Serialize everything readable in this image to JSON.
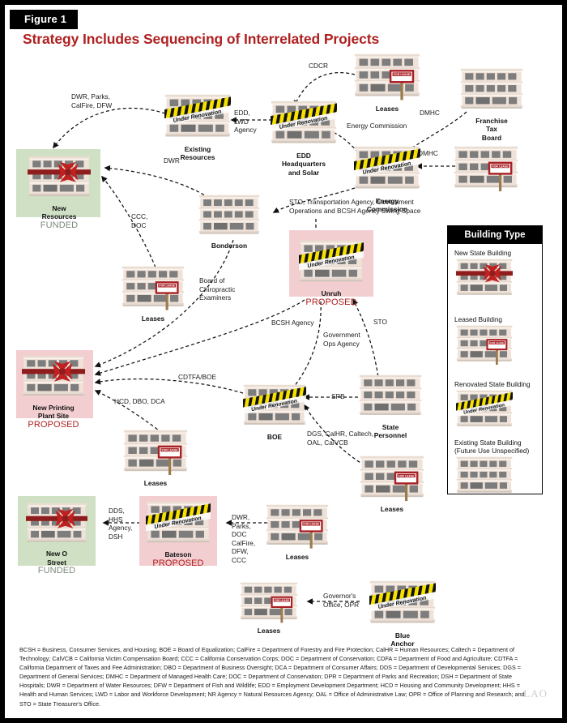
{
  "figure": {
    "tag": "Figure 1",
    "title": "Strategy Includes Sequencing of Interrelated Projects",
    "logo": "LAO"
  },
  "legend": {
    "header": "Building Type",
    "items": [
      {
        "label": "New State Building",
        "icon": "new-state-building-icon"
      },
      {
        "label": "Leased Building",
        "icon": "leased-building-icon"
      },
      {
        "label": "Renovated State Building",
        "icon": "renovated-state-building-icon"
      },
      {
        "label": "Existing State Building\n(Future Use Unspecified)",
        "icon": "existing-state-building-icon"
      }
    ]
  },
  "nodes": [
    {
      "id": "leases_top",
      "caption": "Leases",
      "status": "",
      "type": "leased"
    },
    {
      "id": "franchise_tax",
      "caption": "Franchise\nTax Board",
      "status": "",
      "type": "existing"
    },
    {
      "id": "existing_resources",
      "caption": "Existing Resources",
      "status": "",
      "type": "renovated"
    },
    {
      "id": "edd_hq",
      "caption": "EDD Headquarters\nand Solar",
      "status": "",
      "type": "renovated"
    },
    {
      "id": "energy_commission",
      "caption": "Energy Commission",
      "status": "",
      "type": "renovated"
    },
    {
      "id": "leases_dmhc",
      "caption": "",
      "status": "",
      "type": "leased"
    },
    {
      "id": "new_resources",
      "caption": "New Resources",
      "status": "FUNDED",
      "type": "new",
      "shade": "green"
    },
    {
      "id": "bonderson",
      "caption": "Bonderson",
      "status": "",
      "type": "existing"
    },
    {
      "id": "unruh",
      "caption": "Unruh",
      "status": "PROPOSED",
      "type": "renovated",
      "shade": "pink"
    },
    {
      "id": "leases_chiro",
      "caption": "Leases",
      "status": "",
      "type": "leased"
    },
    {
      "id": "new_printing",
      "caption": "New Printing\nPlant Site",
      "status": "PROPOSED",
      "type": "new",
      "shade": "pink"
    },
    {
      "id": "boe",
      "caption": "BOE",
      "status": "",
      "type": "renovated"
    },
    {
      "id": "state_personnel",
      "caption": "State Personnel",
      "status": "",
      "type": "existing"
    },
    {
      "id": "leases_hcd",
      "caption": "Leases",
      "status": "",
      "type": "leased"
    },
    {
      "id": "leases_dgs",
      "caption": "Leases",
      "status": "",
      "type": "leased"
    },
    {
      "id": "new_o_street",
      "caption": "New O Street",
      "status": "FUNDED",
      "type": "new",
      "shade": "green"
    },
    {
      "id": "bateson",
      "caption": "Bateson",
      "status": "PROPOSED",
      "type": "renovated",
      "shade": "pink"
    },
    {
      "id": "leases_bateson",
      "caption": "Leases",
      "status": "",
      "type": "leased"
    },
    {
      "id": "leases_gov",
      "caption": "Leases",
      "status": "",
      "type": "leased"
    },
    {
      "id": "blue_anchor",
      "caption": "Blue Anchor",
      "status": "",
      "type": "renovated"
    }
  ],
  "edge_labels": [
    {
      "id": "lbl_cdcr",
      "text": "CDCR"
    },
    {
      "id": "lbl_dwr_parks",
      "text": "DWR, Parks,\nCalFire, DFW"
    },
    {
      "id": "lbl_edd_lwd",
      "text": "EDD,\nLWD\nAgency"
    },
    {
      "id": "lbl_dmhc_1",
      "text": "DMHC"
    },
    {
      "id": "lbl_dmhc_2",
      "text": "DMHC"
    },
    {
      "id": "lbl_energy_comm",
      "text": "Energy Commission"
    },
    {
      "id": "lbl_dwr",
      "text": "DWR"
    },
    {
      "id": "lbl_ccc_doc",
      "text": "CCC,\nDOC"
    },
    {
      "id": "lbl_sto_swing",
      "text": "STO, Transportation Agency, Government\nOperations and BCSH Agency Swing Space"
    },
    {
      "id": "lbl_chiro",
      "text": "Board of\nChiropractic\nExaminers"
    },
    {
      "id": "lbl_bcsh",
      "text": "BCSH Agency"
    },
    {
      "id": "lbl_gov_ops",
      "text": "Government\nOps Agency"
    },
    {
      "id": "lbl_sto",
      "text": "STO"
    },
    {
      "id": "lbl_cdtfa_boe",
      "text": "CDTFA/BOE"
    },
    {
      "id": "lbl_spb",
      "text": "SPB"
    },
    {
      "id": "lbl_hcd_dbo_dca",
      "text": "HCD, DBO, DCA"
    },
    {
      "id": "lbl_dgs_calhr",
      "text": "DGS, CalHR, Caltech,\nOAL, CalVCB"
    },
    {
      "id": "lbl_dds_hhs",
      "text": "DDS,\nHHS\nAgency,\nDSH"
    },
    {
      "id": "lbl_dwr_parks2",
      "text": "DWR,\nParks,\nDOC\nCalFire,\nDFW,\nCCC"
    },
    {
      "id": "lbl_gov_opr",
      "text": "Governor's\nOffice, OPR"
    }
  ],
  "footnote": "BCSH = Business, Consumer Services, and Housing; BOE = Board of Equalization; CalFire = Department of Forestry and Fire Protection; CalHR = Human Resources; Caltech = Department of Technology; CalVCB = California Victim Compensation Board; CCC = California Conservation Corps; DOC = Department of Conservation; CDFA = Department of Food and Agriculture; CDTFA = California Department of Taxes and Fee Administration; DBO = Department of Business Oversight; DCA = Department of Consumer Affairs; DDS = Department of Developmental Services; DGS = Department of General Services; DMHC = Department of Managed Health Care; DOC = Department of Conservation; DPR = Department of Parks and Recreation; DSH = Department of State Hospitals; DWR = Department of Water Resources;  DFW = Department of Fish and Wildlife; EDD = Employment Development Department; HCD = Housing and Community Development; HHS = Health and Human Services; LWD = Labor and Workforce Development; NR Agency = Natural Resources Agency; OAL = Office of Administrative Law; OPR = Office of Planning and Research; and STO = State Treasurer's Office.",
  "colors": {
    "title": "#B02020",
    "proposed": "#B02020",
    "funded": "#7d8a7d",
    "shade_green": "#cfe0c4",
    "shade_pink": "#f2ced1",
    "building_facade": "#efe2d9",
    "window": "#7d7d7d",
    "sign_red": "#a81f24",
    "tape_yellow": "#f5e000"
  }
}
